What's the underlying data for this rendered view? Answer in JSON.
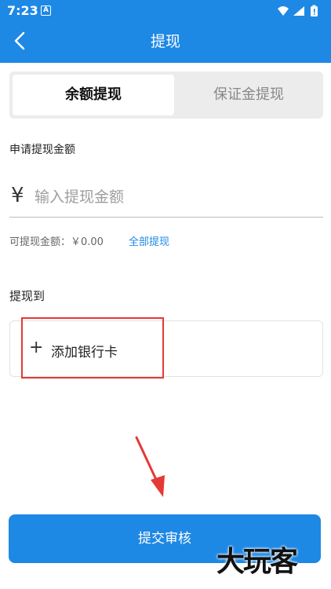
{
  "status_bar": {
    "time": "7:23",
    "notification_glyph": "A",
    "icons": [
      "wifi-icon",
      "signal-icon",
      "battery-icon"
    ]
  },
  "app_bar": {
    "title": "提现",
    "back_icon": "back-chevron-icon"
  },
  "tabs": [
    {
      "label": "余额提现",
      "active": true
    },
    {
      "label": "保证金提现",
      "active": false
    }
  ],
  "form": {
    "amount_label": "申请提现金额",
    "currency_symbol": "¥",
    "amount_placeholder": "输入提现金额",
    "available_text": "可提现金额：￥0.00",
    "withdraw_all_label": "全部提现"
  },
  "destination": {
    "label": "提现到",
    "add_card_icon": "plus-icon",
    "add_card_label": "添加银行卡"
  },
  "submit_label": "提交审核",
  "watermark": "大玩客",
  "colors": {
    "primary": "#1e88e5",
    "highlight": "#e53935"
  }
}
